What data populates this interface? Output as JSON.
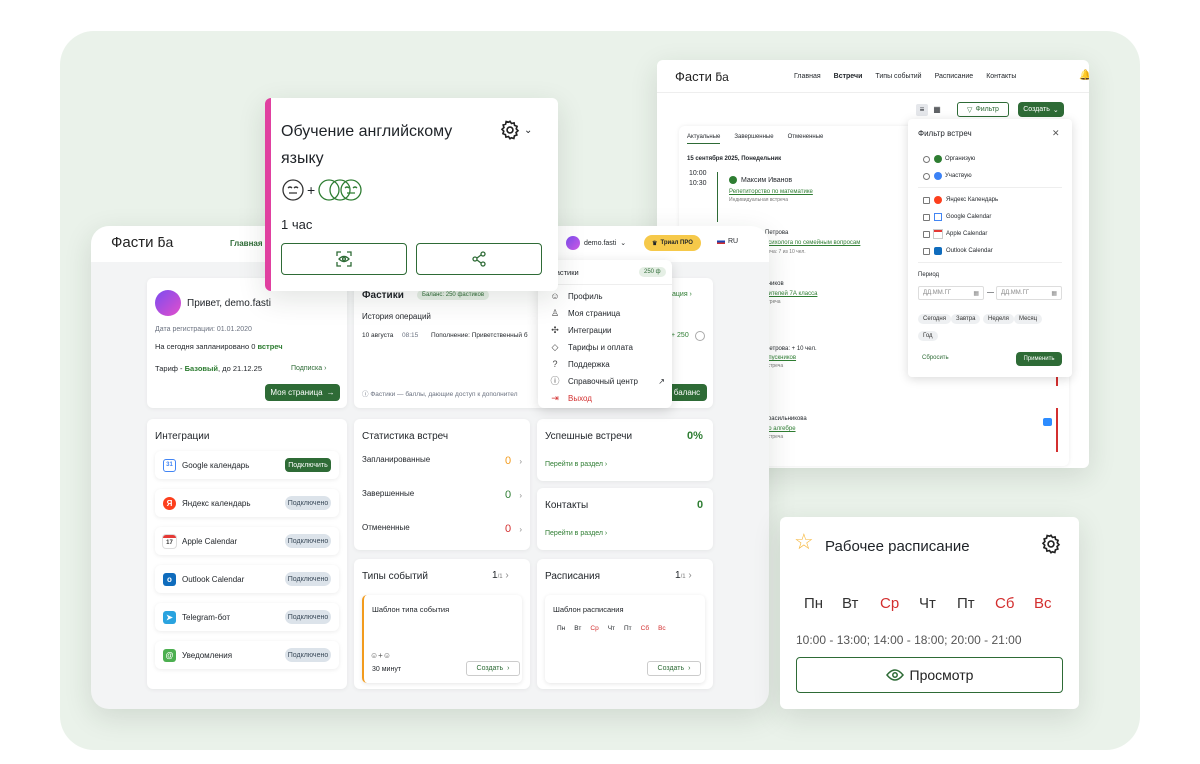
{
  "colors": {
    "accent": "#2e6b36",
    "bg": "#eaf2ea",
    "red": "#d32f2f",
    "orange": "#f29b1d",
    "pink": "#e040a0",
    "pro": "#f6c94a"
  },
  "logo": {
    "text": "Фасти",
    "mark": "ƃa"
  },
  "nav_top": {
    "items": [
      "Главная",
      "Встречи",
      "Типы событий",
      "Расписание",
      "Контакты"
    ],
    "active": "Встречи"
  },
  "toolbar": {
    "filter": "Фильтр",
    "create": "Создать"
  },
  "tabs": [
    "Актуальные",
    "Завершенные",
    "Отмененные"
  ],
  "events": {
    "date": "15 сентября 2025, Понедельник",
    "time_from": "10:00",
    "time_to": "10:30",
    "e1_name": "Максим Иванов",
    "e1_link": "Репетиторство по математике",
    "e1_sub": "Индивидуальная встреча",
    "e2_name": "Петрова",
    "e2_link": "психолога по семейным вопросам",
    "e2_sub": "реча: 7 из 10 чел.",
    "e3_name": "тников",
    "e3_link": "дителей 7А класса",
    "e3_sub": "стреча",
    "e4_name": "Петрова: + 10 чел.",
    "e4_link": "ипускников",
    "e4_sub": "встреча",
    "e5_name": "Грасильникова",
    "e5_link": "по алгебре",
    "e5_sub": "встреча"
  },
  "filter": {
    "title": "Фильтр встреч",
    "close": "✕",
    "roles": [
      "Организую",
      "Участвую"
    ],
    "calendars": [
      "Яндекс Календарь",
      "Google Calendar",
      "Apple Calendar",
      "Outlook Calendar"
    ],
    "period": "Период",
    "from": "ДД.ММ.ГГ",
    "to": "ДД.ММ.ГГ",
    "chips": [
      "Сегодня",
      "Завтра",
      "Неделя",
      "Месяц",
      "Год"
    ],
    "reset": "Сбросить",
    "apply": "Применить"
  },
  "header_main": {
    "home": "Главная",
    "user": "demo.fasti",
    "pro": "Триал ПРО",
    "lang": "RU"
  },
  "course": {
    "title_l1": "Обучение английскому",
    "title_l2": "языку",
    "duration": "1 час"
  },
  "dropdown": {
    "balance_label": "Фастики",
    "balance": "250 ф",
    "items": [
      "Профиль",
      "Моя страница",
      "Интеграции",
      "Тарифы и оплата",
      "Поддержка",
      "Справочный центр",
      "Выход"
    ]
  },
  "welcome": {
    "greet": "Привет, demo.fasti",
    "reg": "Дата регистрации: 01.01.2020",
    "today": "На сегодня запланировано 0 ",
    "today_bold": "встреч",
    "tariff_pre": "Тариф - ",
    "tariff_plan": "Базовый",
    "tariff_post": ", до 21.12.25",
    "subscription": "Подписка",
    "my_page": "Моя страница"
  },
  "fastiki": {
    "title": "Фастики",
    "balance_badge": "Баланс: 250 фастиков",
    "history": "История операций",
    "date": "10 августа",
    "time": "08:15",
    "op": "Пополнение: Приветственный б",
    "ops_link": "ация",
    "amount": "+ 250",
    "note": "Фастики — баллы, дающие доступ к дополнител",
    "topup": "баланс"
  },
  "integrations": {
    "title": "Интеграции",
    "items": [
      {
        "name": "Google календарь",
        "status": "Подключить"
      },
      {
        "name": "Яндекс календарь",
        "status": "Подключено"
      },
      {
        "name": "Apple Calendar",
        "status": "Подключено"
      },
      {
        "name": "Outlook Calendar",
        "status": "Подключено"
      },
      {
        "name": "Telegram-бот",
        "status": "Подключено"
      },
      {
        "name": "Уведомления",
        "status": "Подключено"
      }
    ]
  },
  "stats": {
    "title": "Статистика встреч",
    "rows": [
      {
        "label": "Запланированные",
        "value": "0"
      },
      {
        "label": "Завершенные",
        "value": "0"
      },
      {
        "label": "Отмененные",
        "value": "0"
      }
    ]
  },
  "success": {
    "title": "Успешные встречи",
    "value": "0%",
    "link": "Перейти в раздел"
  },
  "contacts": {
    "title": "Контакты",
    "value": "0",
    "link": "Перейти в раздел"
  },
  "types": {
    "title": "Типы событий",
    "count": "1",
    "of": "/1",
    "tpl": "Шаблон типа события",
    "dur": "30 минут",
    "create": "Создать"
  },
  "schedules": {
    "title": "Расписания",
    "count": "1",
    "of": "/1",
    "tpl": "Шаблон расписания",
    "days": [
      "Пн",
      "Вт",
      "Ср",
      "Чт",
      "Пт",
      "Сб",
      "Вс"
    ],
    "create": "Создать"
  },
  "work": {
    "title": "Рабочее расписание",
    "days": [
      "Пн",
      "Вт",
      "Ср",
      "Чт",
      "Пт",
      "Сб",
      "Вс"
    ],
    "hours": "10:00 - 13:00; 14:00 - 18:00; 20:00 - 21:00",
    "view": "Просмотр"
  }
}
